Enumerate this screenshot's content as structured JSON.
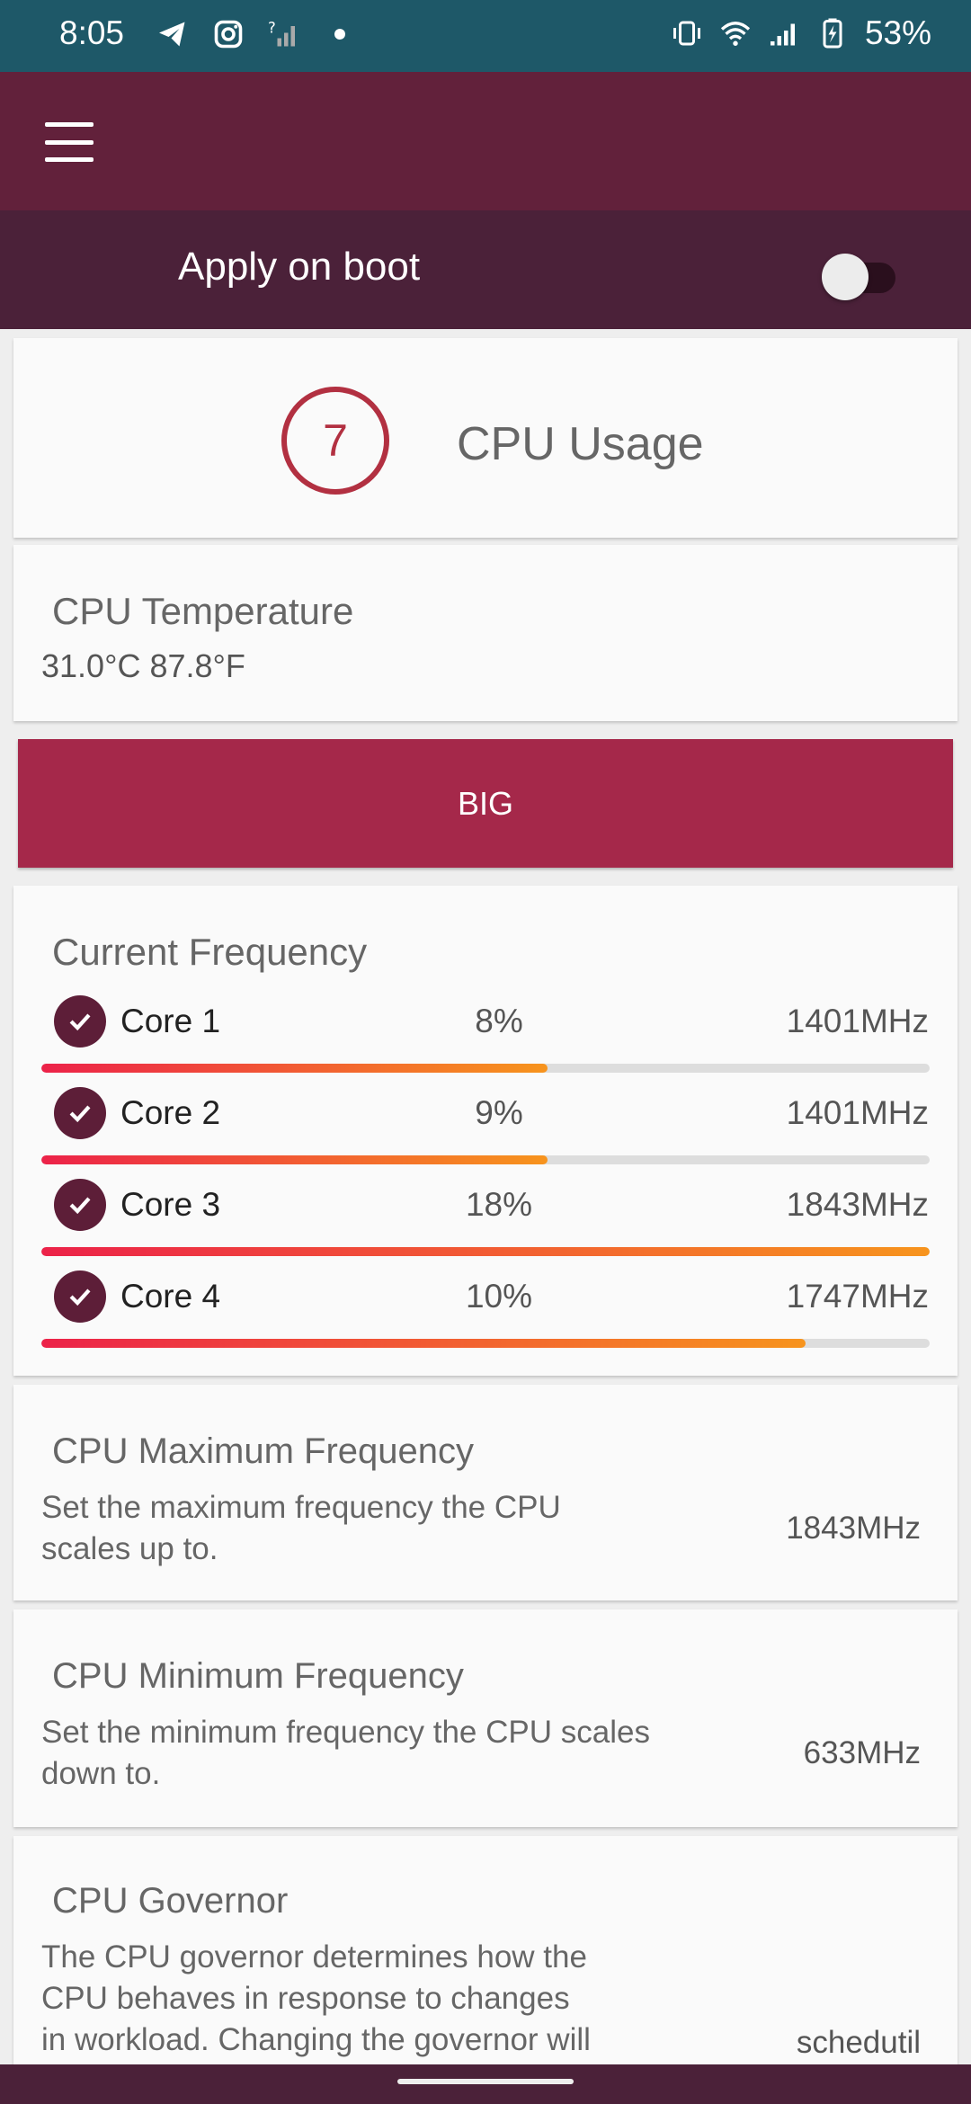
{
  "status_bar": {
    "time": "8:05",
    "left_icons": [
      "telegram-icon",
      "instagram-icon",
      "no-sim-icon",
      "dot-icon"
    ],
    "right_icons": [
      "vibrate-icon",
      "wifi-icon",
      "signal-icon",
      "battery-charging-icon"
    ],
    "battery": "53%"
  },
  "app_bar": {
    "menu_icon": "hamburger-menu-icon"
  },
  "boot": {
    "label": "Apply on boot",
    "enabled": false
  },
  "cpu_usage": {
    "value": "7",
    "title": "CPU Usage"
  },
  "cpu_temperature": {
    "title": "CPU Temperature",
    "value": "31.0°C 87.8°F"
  },
  "cluster_button": {
    "label": "BIG"
  },
  "current_frequency": {
    "title": "Current Frequency",
    "cores": [
      {
        "label": "Core 1",
        "percent": "8%",
        "freq": "1401MHz",
        "bar_fraction": 0.57
      },
      {
        "label": "Core 2",
        "percent": "9%",
        "freq": "1401MHz",
        "bar_fraction": 0.57
      },
      {
        "label": "Core 3",
        "percent": "18%",
        "freq": "1843MHz",
        "bar_fraction": 1.0
      },
      {
        "label": "Core 4",
        "percent": "10%",
        "freq": "1747MHz",
        "bar_fraction": 0.86
      }
    ]
  },
  "max_freq": {
    "title": "CPU Maximum Frequency",
    "summary_line1": "Set the maximum frequency the CPU",
    "summary_line2": "scales up to.",
    "value": "1843MHz"
  },
  "min_freq": {
    "title": "CPU Minimum Frequency",
    "summary_line1": "Set the minimum frequency the CPU scales",
    "summary_line2": "down to.",
    "value": "633MHz"
  },
  "governor": {
    "title": "CPU Governor",
    "summary_line1": "The CPU governor determines how the",
    "summary_line2": "CPU behaves in response to changes",
    "summary_line3": "in workload. Changing the governor will",
    "value": "schedutil"
  },
  "colors": {
    "status_bar": "#1e5868",
    "app_bar": "#62213b",
    "boot_bar": "#4b2139",
    "accent": "#a5284a",
    "bar_start": "#ec2249",
    "bar_end": "#f7941d"
  }
}
